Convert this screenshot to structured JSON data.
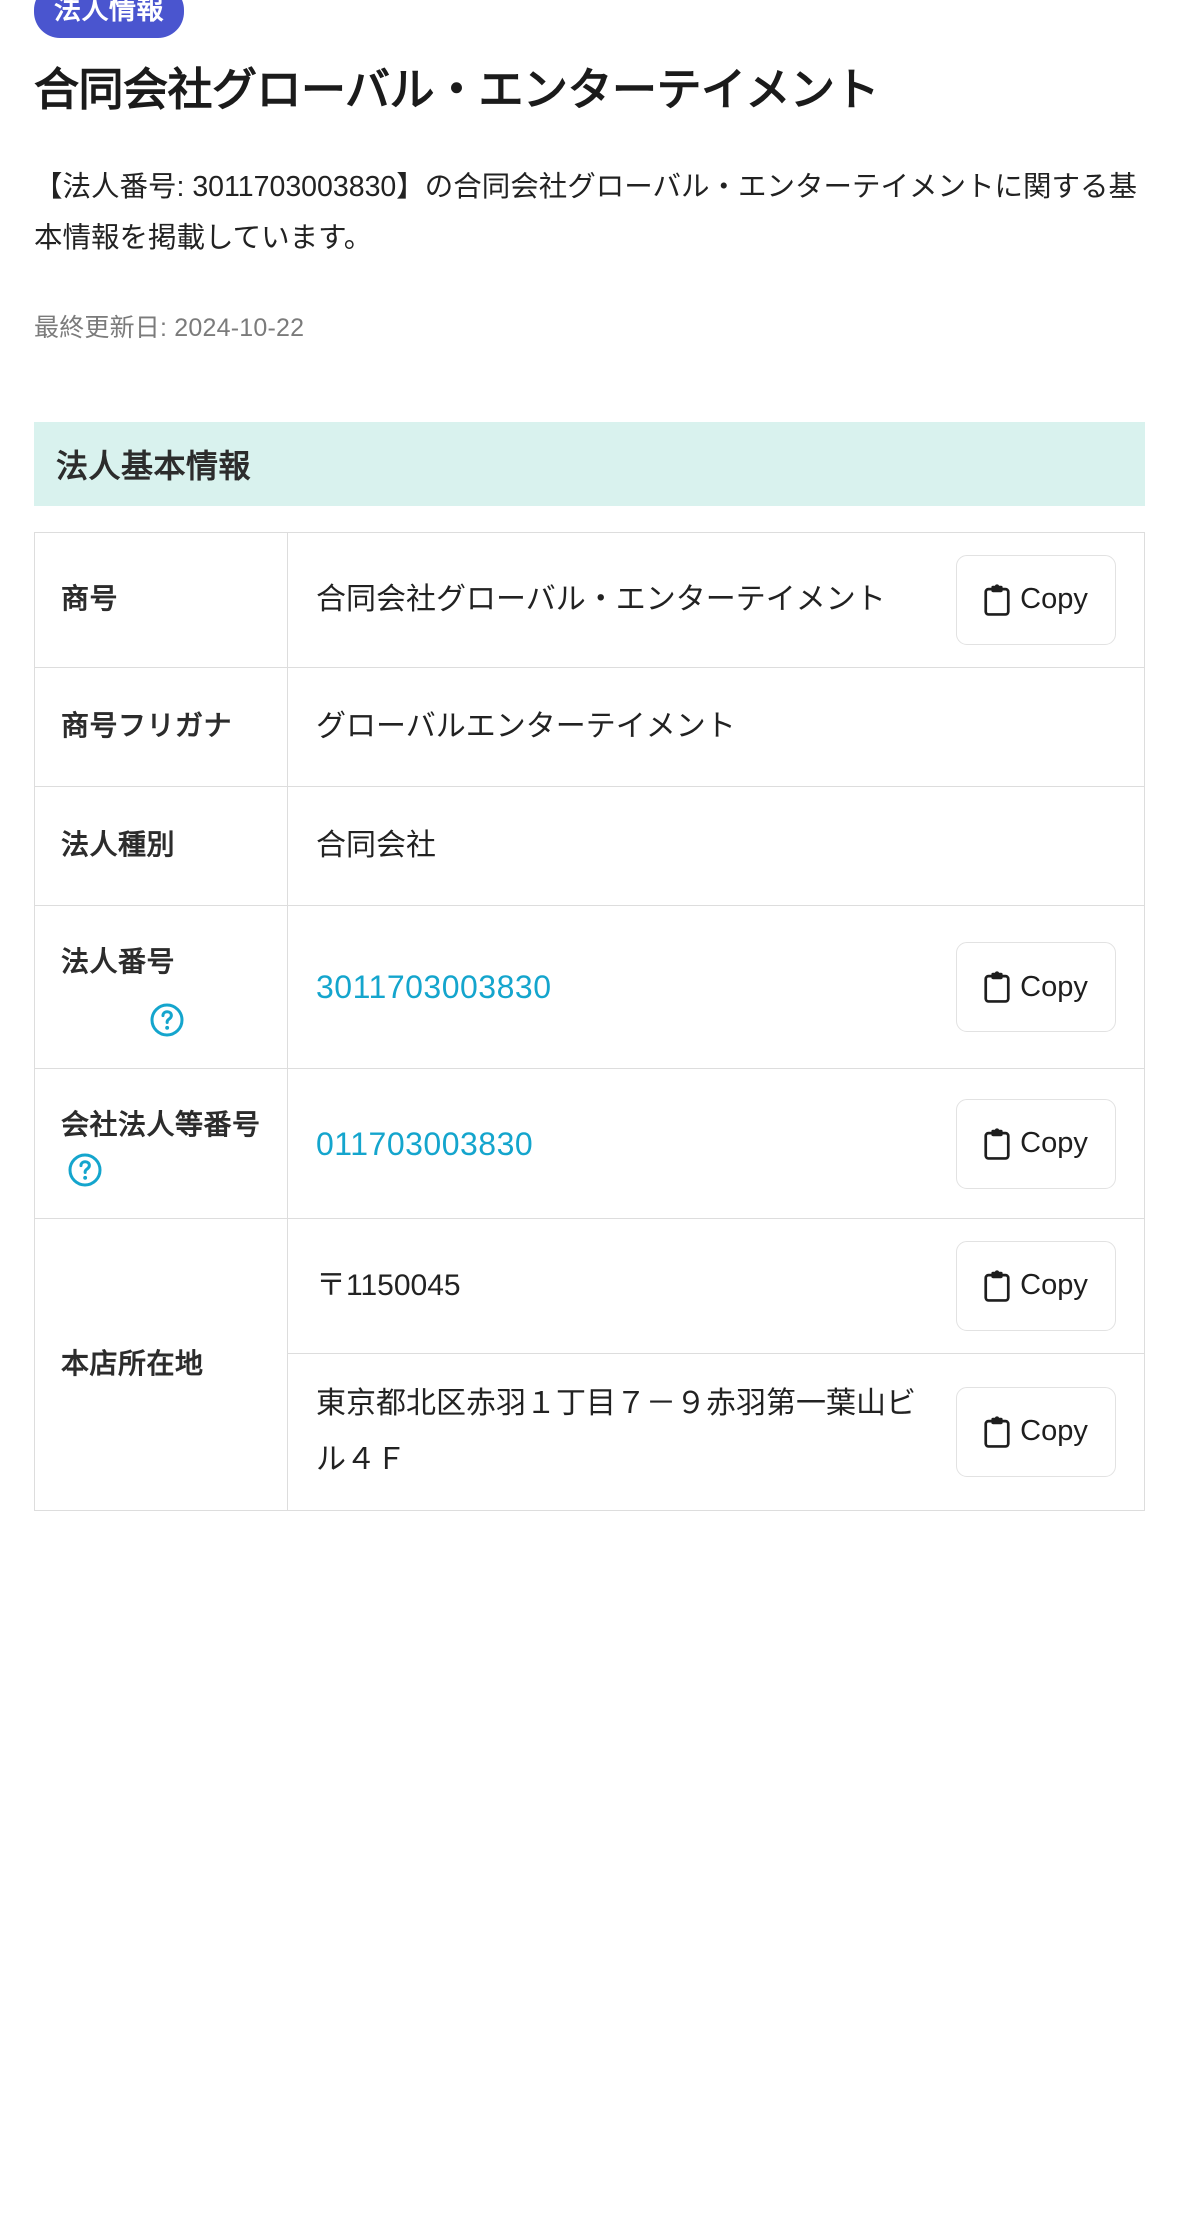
{
  "badge": {
    "label": "法人情報"
  },
  "header": {
    "title": "合同会社グローバル・エンターテイメント",
    "description": "【法人番号: 3011703003830】の合同会社グローバル・エンターテイメントに関する基本情報を掲載しています。",
    "updated": "最終更新日: 2024-10-22"
  },
  "section": {
    "title": "法人基本情報"
  },
  "table": {
    "rows": [
      {
        "label": "商号",
        "value": "合同会社グローバル・エンターテイメント",
        "has_copy": true,
        "is_link": false,
        "has_help": false
      },
      {
        "label": "商号フリガナ",
        "value": "グローバルエンターテイメント",
        "has_copy": false,
        "is_link": false,
        "has_help": false
      },
      {
        "label": "法人種別",
        "value": "合同会社",
        "has_copy": false,
        "is_link": false,
        "has_help": false
      },
      {
        "label": "法人番号",
        "value": "3011703003830",
        "has_copy": true,
        "is_link": true,
        "has_help": true,
        "help_position": "below"
      },
      {
        "label": "会社法人等番号",
        "value": "011703003830",
        "has_copy": true,
        "is_link": true,
        "has_help": true,
        "help_position": "inline"
      }
    ],
    "address_row": {
      "label": "本店所在地",
      "lines": [
        {
          "value": "〒1150045",
          "has_copy": true
        },
        {
          "value": "東京都北区赤羽１丁目７－９赤羽第一葉山ビル４Ｆ",
          "has_copy": true
        }
      ]
    }
  },
  "buttons": {
    "copy_label": "Copy"
  },
  "icons": {
    "copy": "clipboard-icon",
    "help": "question-circle-icon"
  },
  "colors": {
    "badge_bg": "#4a55cf",
    "section_bg": "#d9f2ee",
    "link": "#14a5cd",
    "help": "#14a5cd",
    "border": "#dddddd",
    "muted_text": "#7b7b7b"
  }
}
